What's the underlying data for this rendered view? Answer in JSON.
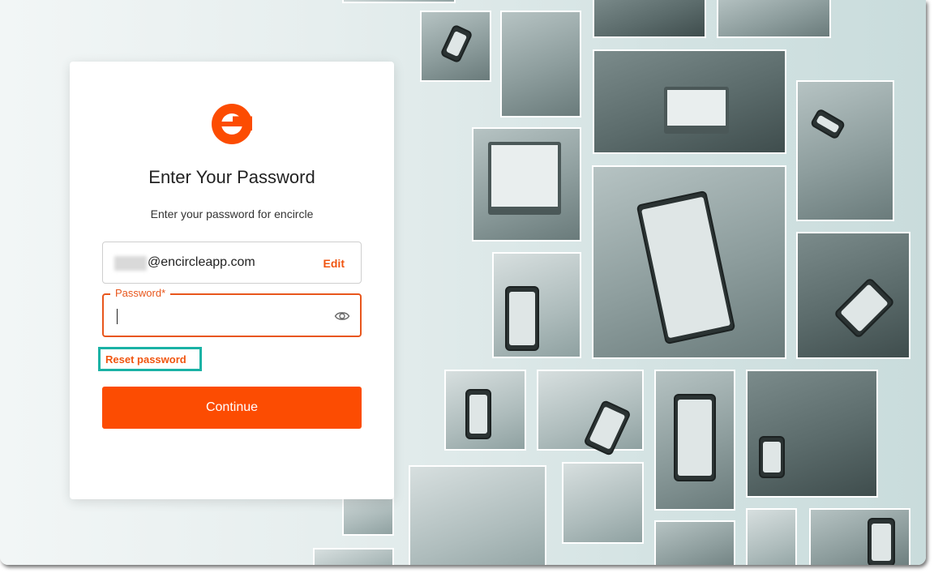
{
  "brand": {
    "accent_color": "#fc4c02",
    "highlight_color": "#1ab2a5",
    "logo_icon": "encircle-logo-icon"
  },
  "login": {
    "title": "Enter Your Password",
    "subtitle": "Enter your password for encircle",
    "email_value": "@encircleapp.com",
    "edit_label": "Edit",
    "password_label": "Password*",
    "password_value": "",
    "show_password_icon": "eye-icon",
    "reset_label": "Reset password",
    "continue_label": "Continue"
  },
  "background": {
    "description_icon": "photo-collage"
  }
}
